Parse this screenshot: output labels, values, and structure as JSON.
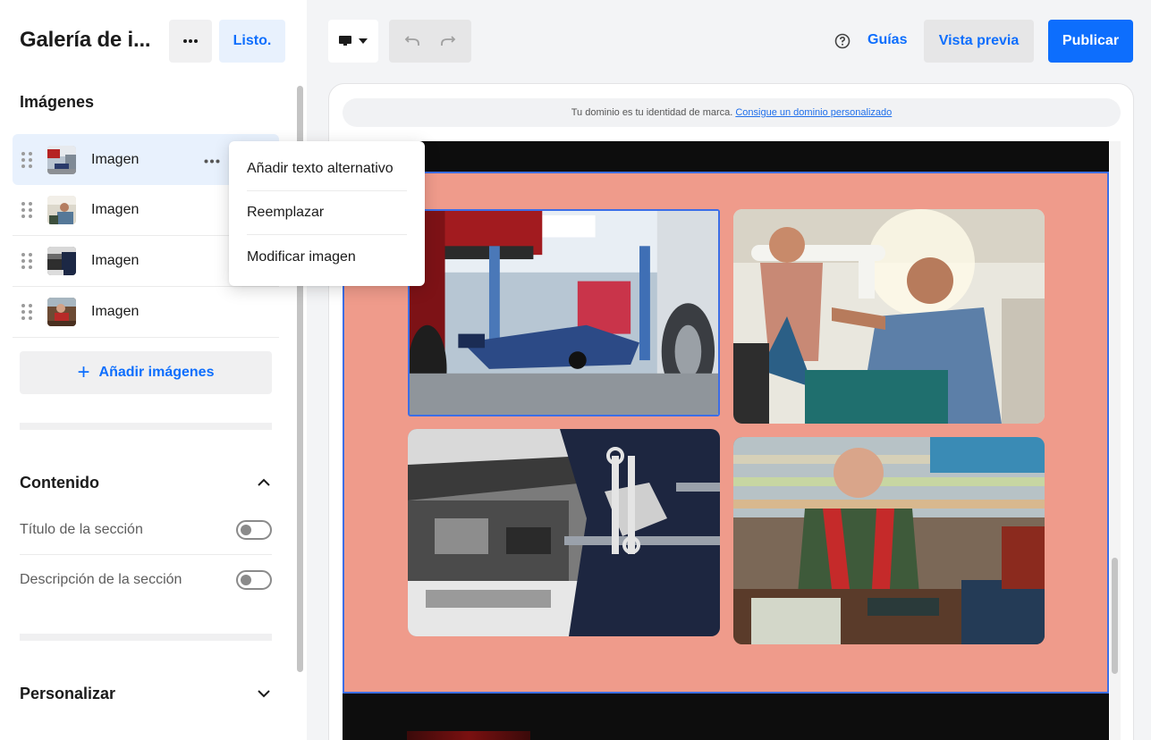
{
  "sidebar": {
    "title": "Galería de i...",
    "more_icon": "more-horizontal-icon",
    "done_label": "Listo.",
    "images_section": {
      "title": "Imágenes",
      "items": [
        {
          "label": "Imagen",
          "active": true
        },
        {
          "label": "Imagen",
          "active": false
        },
        {
          "label": "Imagen",
          "active": false
        },
        {
          "label": "Imagen",
          "active": false
        }
      ],
      "add_label": "Añadir imágenes"
    },
    "content_section": {
      "title": "Contenido",
      "expanded": true,
      "toggles": [
        {
          "label": "Título de la sección",
          "on": false
        },
        {
          "label": "Descripción de la sección",
          "on": false
        }
      ]
    },
    "customize_section": {
      "title": "Personalizar",
      "expanded": false
    }
  },
  "context_menu": {
    "items": [
      "Añadir texto alternativo",
      "Reemplazar",
      "Modificar imagen"
    ]
  },
  "toolbar": {
    "device_icon": "desktop-icon",
    "undo_icon": "undo-icon",
    "redo_icon": "redo-icon",
    "help_icon": "help-circle-icon",
    "guides_label": "Guías",
    "preview_label": "Vista previa",
    "publish_label": "Publicar"
  },
  "canvas": {
    "domain_notice": "Tu dominio es tu identidad de marca.",
    "domain_link": "Consigue un dominio personalizado",
    "gallery_background": "#ef9b8b",
    "selection_color": "#3c6ee6"
  },
  "colors": {
    "accent": "#0d6efd",
    "accent_light": "#e8f1fd"
  }
}
